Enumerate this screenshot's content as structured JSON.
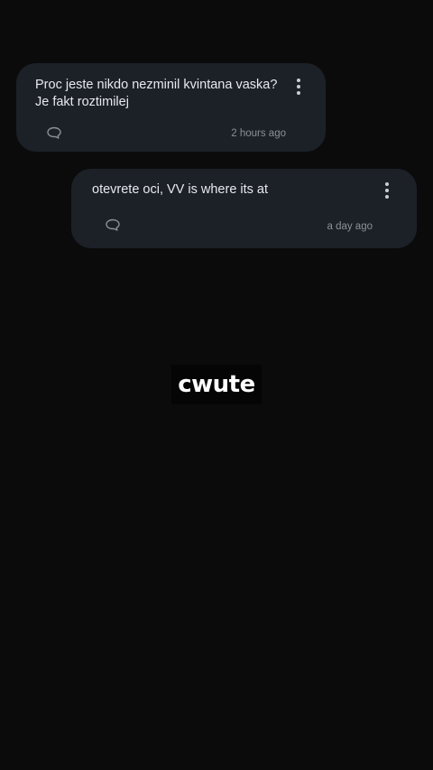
{
  "comments": [
    {
      "text": "Proc jeste nikdo nezminil kvintana vaska? Je fakt roztimilej",
      "timestamp": "2 hours ago",
      "menu_icon": "more-vertical-icon",
      "reply_icon": "comment-icon"
    },
    {
      "text": "otevrete oci, VV is where its at",
      "timestamp": "a day ago",
      "menu_icon": "more-vertical-icon",
      "reply_icon": "comment-icon"
    }
  ],
  "overlay_caption": "cwute",
  "colors": {
    "background": "#0b0b0c",
    "bubble": "#1c2128",
    "text": "#e6e9ed",
    "muted": "#8a9099",
    "caption_bg": "#050505",
    "caption_text": "#ffffff"
  }
}
